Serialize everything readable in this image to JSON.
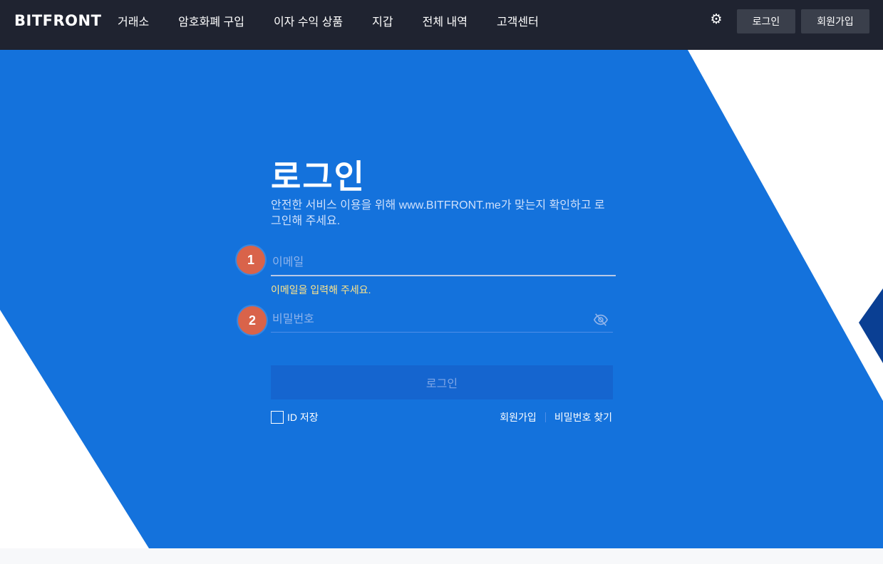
{
  "header": {
    "logo": "BITFRONT",
    "nav": [
      "거래소",
      "암호화폐 구입",
      "이자 수익 상품",
      "지갑",
      "전체 내역",
      "고객센터"
    ],
    "settings_icon": "gear-icon",
    "login_label": "로그인",
    "signup_label": "회원가입"
  },
  "login": {
    "title": "로그인",
    "description": "안전한 서비스 이용을 위해 www.BITFRONT.me가 맞는지 확인하고 로그인해 주세요.",
    "email_placeholder": "이메일",
    "email_error": "이메일을 입력해 주세요.",
    "password_placeholder": "비밀번호",
    "submit_label": "로그인",
    "remember_label": "ID 저장",
    "signup_link": "회원가입",
    "find_password_link": "비밀번호 찾기"
  },
  "annotations": {
    "badge1": "1",
    "badge2": "2"
  },
  "colors": {
    "header_bg": "#1f2330",
    "hero_blue": "#1472dc",
    "dark_blue": "#0a3f93",
    "badge": "#d9634a",
    "error_text": "#ffe58a"
  }
}
